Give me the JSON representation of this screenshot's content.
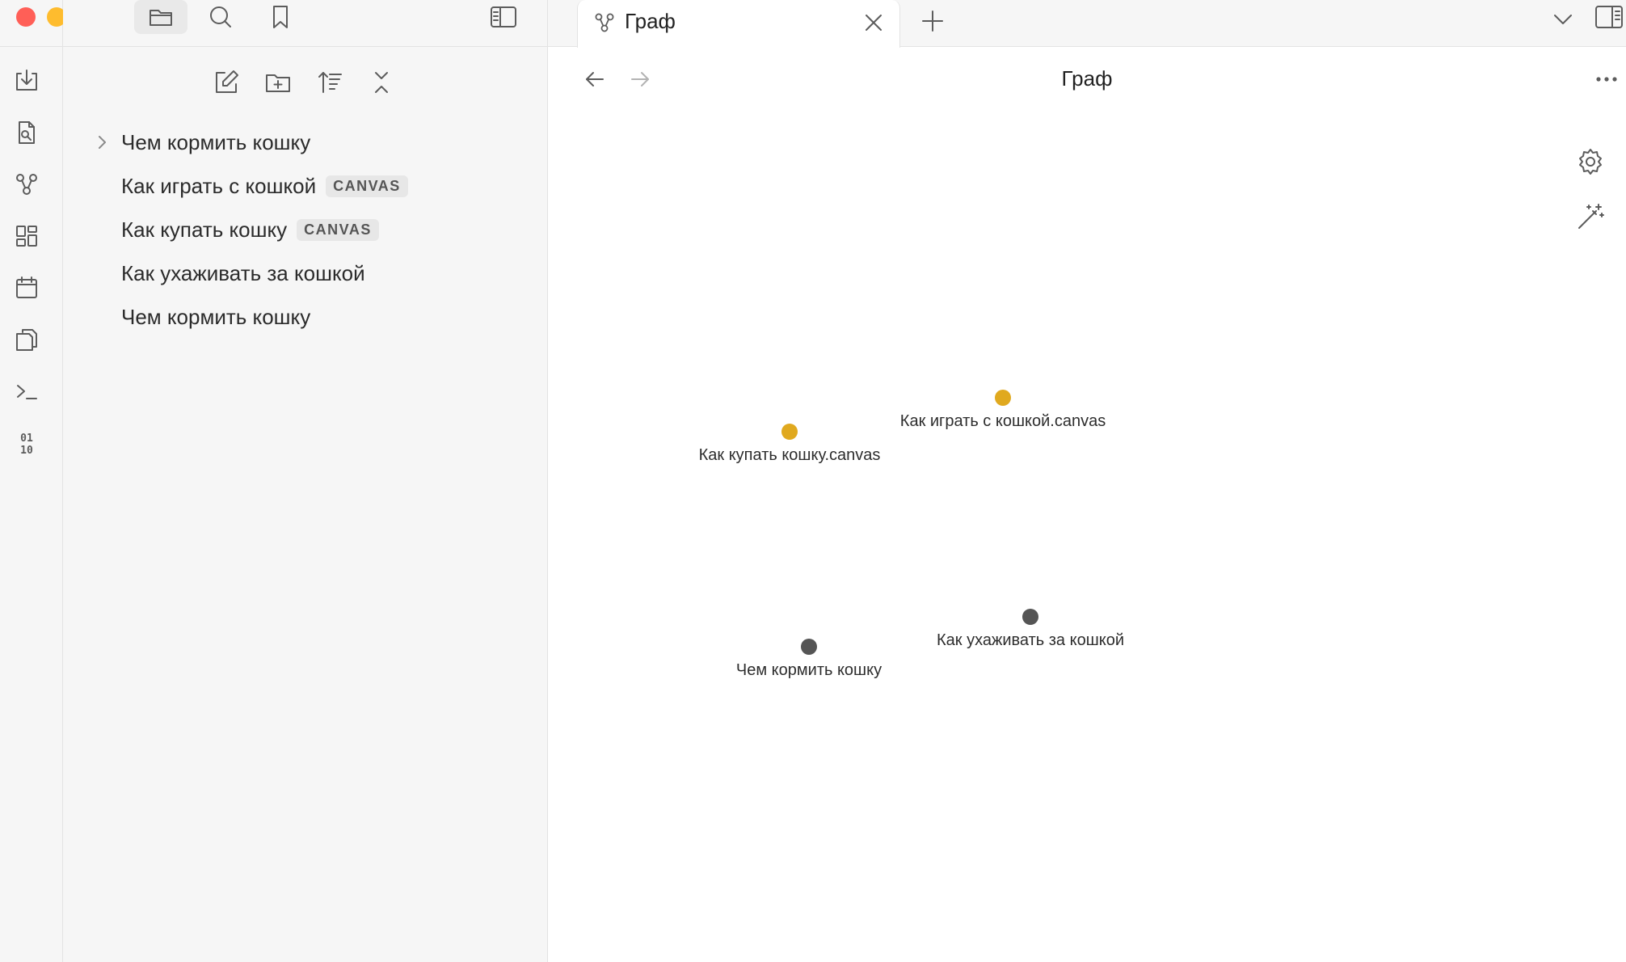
{
  "colors": {
    "canvas_node": "#e0a91f",
    "note_node": "#555555",
    "traffic_close": "#ff5f57",
    "traffic_min": "#febc2e",
    "traffic_max": "#28c840"
  },
  "sidebar": {
    "tabs": [
      "folder-icon",
      "search-icon",
      "bookmark-icon"
    ],
    "file_tree": [
      {
        "label": "Чем кормить кошку",
        "type": "folder"
      },
      {
        "label": "Как играть с кошкой",
        "badge": "CANVAS"
      },
      {
        "label": "Как купать кошку",
        "badge": "CANVAS"
      },
      {
        "label": "Как ухаживать за кошкой"
      },
      {
        "label": "Чем кормить кошку"
      }
    ]
  },
  "tab": {
    "title": "Граф",
    "icon": "graph-icon"
  },
  "view": {
    "title": "Граф"
  },
  "graph": {
    "nodes": [
      {
        "label": "Как играть с кошкой.canvas",
        "kind": "canvas"
      },
      {
        "label": "Как купать кошку.canvas",
        "kind": "canvas"
      },
      {
        "label": "Как ухаживать за кошкой",
        "kind": "note"
      },
      {
        "label": "Чем кормить кошку",
        "kind": "note"
      }
    ]
  }
}
